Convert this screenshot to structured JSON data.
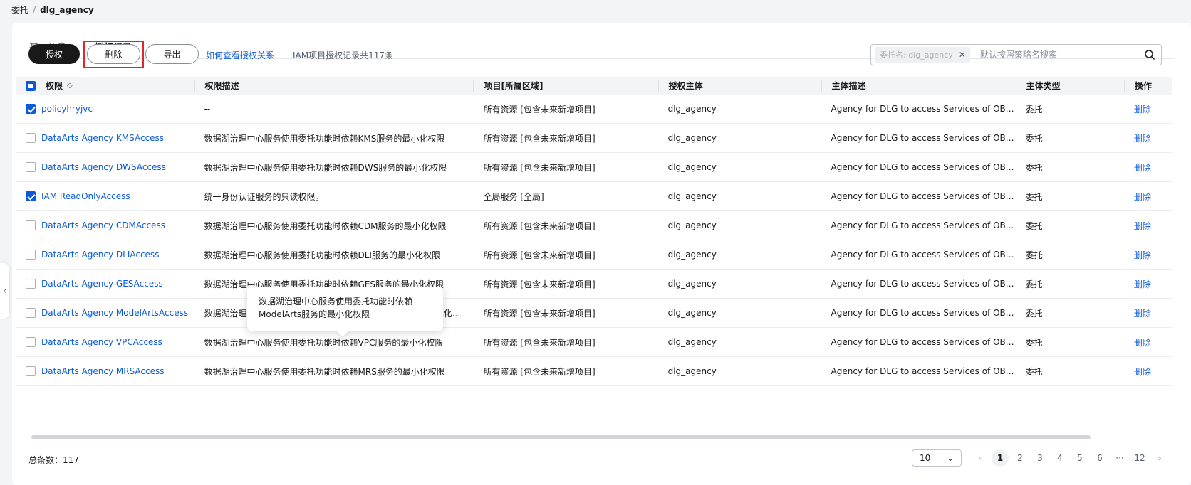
{
  "breadcrumb": {
    "parent": "委托",
    "separator": "/",
    "current": "dlg_agency"
  },
  "tabs": [
    {
      "label": "基本信息"
    },
    {
      "label": "授权记录"
    }
  ],
  "toolbar": {
    "grant": "授权",
    "delete": "删除",
    "export": "导出",
    "help_link": "如何查看授权关系",
    "record_count": "IAM项目授权记录共117条"
  },
  "search": {
    "tag": "委托名: dlg_agency",
    "placeholder": "默认按照策略名搜索"
  },
  "table": {
    "headers": [
      "权限",
      "权限描述",
      "项目[所属区域]",
      "授权主体",
      "主体描述",
      "主体类型",
      "操作"
    ],
    "rows": [
      {
        "checked": true,
        "name": "policyhryjvc",
        "desc": "--",
        "project": "所有资源 [包含未来新增项目]",
        "principal": "dlg_agency",
        "principal_desc": "Agency for DLG to access Services of OBS...",
        "type": "委托",
        "action": "删除"
      },
      {
        "checked": false,
        "name": "DataArts Agency KMSAccess",
        "desc": "数据湖治理中心服务使用委托功能时依赖KMS服务的最小化权限",
        "project": "所有资源 [包含未来新增项目]",
        "principal": "dlg_agency",
        "principal_desc": "Agency for DLG to access Services of OBS...",
        "type": "委托",
        "action": "删除"
      },
      {
        "checked": false,
        "name": "DataArts Agency DWSAccess",
        "desc": "数据湖治理中心服务使用委托功能时依赖DWS服务的最小化权限",
        "project": "所有资源 [包含未来新增项目]",
        "principal": "dlg_agency",
        "principal_desc": "Agency for DLG to access Services of OBS...",
        "type": "委托",
        "action": "删除"
      },
      {
        "checked": true,
        "name": "IAM ReadOnlyAccess",
        "desc": "统一身份认证服务的只读权限。",
        "project": "全局服务 [全局]",
        "principal": "dlg_agency",
        "principal_desc": "Agency for DLG to access Services of OBS...",
        "type": "委托",
        "action": "删除"
      },
      {
        "checked": false,
        "name": "DataArts Agency CDMAccess",
        "desc": "数据湖治理中心服务使用委托功能时依赖CDM服务的最小化权限",
        "project": "所有资源 [包含未来新增项目]",
        "principal": "dlg_agency",
        "principal_desc": "Agency for DLG to access Services of OBS...",
        "type": "委托",
        "action": "删除"
      },
      {
        "checked": false,
        "name": "DataArts Agency DLIAccess",
        "desc": "数据湖治理中心服务使用委托功能时依赖DLI服务的最小化权限",
        "project": "所有资源 [包含未来新增项目]",
        "principal": "dlg_agency",
        "principal_desc": "Agency for DLG to access Services of OBS...",
        "type": "委托",
        "action": "删除"
      },
      {
        "checked": false,
        "name": "DataArts Agency GESAccess",
        "desc": "数据湖治理中心服务使用委托功能时依赖GES服务的最小化权限",
        "project": "所有资源 [包含未来新增项目]",
        "principal": "dlg_agency",
        "principal_desc": "Agency for DLG to access Services of OBS...",
        "type": "委托",
        "action": "删除"
      },
      {
        "checked": false,
        "name": "DataArts Agency ModelArtsAccess",
        "desc": "数据湖治理中心服务使用委托功能时依赖ModelArts服务的最小化...",
        "project": "所有资源 [包含未来新增项目]",
        "principal": "dlg_agency",
        "principal_desc": "Agency for DLG to access Services of OBS...",
        "type": "委托",
        "action": "删除"
      },
      {
        "checked": false,
        "name": "DataArts Agency VPCAccess",
        "desc": "数据湖治理中心服务使用委托功能时依赖VPC服务的最小化权限",
        "project": "所有资源 [包含未来新增项目]",
        "principal": "dlg_agency",
        "principal_desc": "Agency for DLG to access Services of OBS...",
        "type": "委托",
        "action": "删除"
      },
      {
        "checked": false,
        "name": "DataArts Agency MRSAccess",
        "desc": "数据湖治理中心服务使用委托功能时依赖MRS服务的最小化权限",
        "project": "所有资源 [包含未来新增项目]",
        "principal": "dlg_agency",
        "principal_desc": "Agency for DLG to access Services of OBS...",
        "type": "委托",
        "action": "删除"
      }
    ]
  },
  "tooltip": {
    "line1": "数据湖治理中心服务使用委托功能时依赖",
    "line2": "ModelArts服务的最小化权限"
  },
  "footer": {
    "total": "总条数：117",
    "page_size": "10",
    "pages": [
      "1",
      "2",
      "3",
      "4",
      "5",
      "6",
      "···",
      "12"
    ],
    "current_page": "1"
  },
  "colors": {
    "accent": "#0b5bd6",
    "primary_button": "#191919",
    "highlight_box": "#e0262d"
  }
}
